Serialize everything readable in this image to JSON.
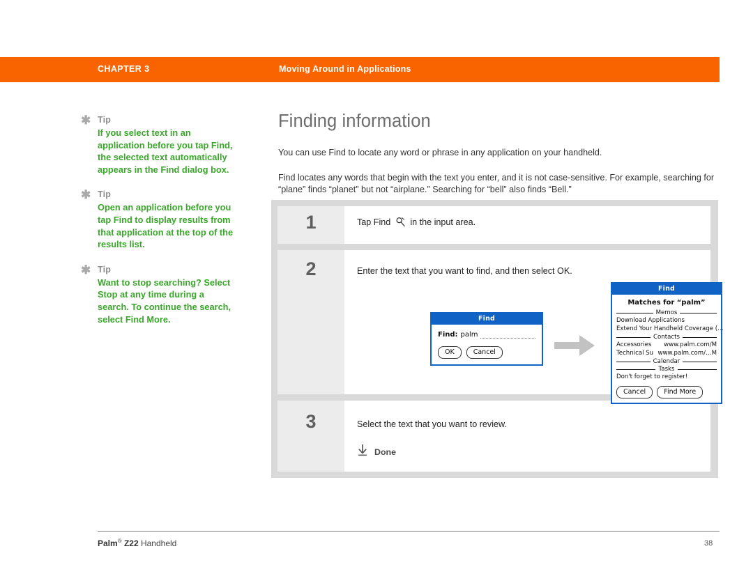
{
  "header": {
    "chapter": "CHAPTER 3",
    "section": "Moving Around in Applications",
    "bar_color": "#FA6400"
  },
  "sidebar": {
    "tips": [
      {
        "label": "Tip",
        "text": "If you select text in an application before you tap Find, the selected text automatically appears in the Find dialog box."
      },
      {
        "label": "Tip",
        "text": "Open an application before you tap Find to display results from that application at the top of the results list."
      },
      {
        "label": "Tip",
        "text": "Want to stop searching? Select Stop at any time during a search. To continue the search, select Find More."
      }
    ],
    "tip_color": "#3AA62B"
  },
  "main": {
    "title": "Finding information",
    "paragraphs": [
      "You can use Find to locate any word or phrase in any application on your handheld.",
      "Find locates any words that begin with the text you enter, and it is not case-sensitive. For example, searching for “plane” finds “planet” but not “airplane.” Searching for “bell” also finds “Bell.”"
    ]
  },
  "steps": [
    {
      "number": "1",
      "text_before": "Tap Find",
      "text_after": "in the input area."
    },
    {
      "number": "2",
      "text": "Enter the text that you want to find, and then select OK."
    },
    {
      "number": "3",
      "text": "Select the text that you want to review.",
      "done_label": "Done"
    }
  ],
  "find_dialog": {
    "title": "Find",
    "field_label": "Find:",
    "field_value": "palm",
    "ok_label": "OK",
    "cancel_label": "Cancel",
    "title_bar_color": "#1062C4"
  },
  "results_dialog": {
    "title": "Find",
    "heading": "Matches for “palm”",
    "groups": [
      {
        "name": "Memos",
        "items": [
          {
            "left": "Download Applications"
          },
          {
            "left": "Extend Your Handheld Coverage (…"
          }
        ]
      },
      {
        "name": "Contacts",
        "items": [
          {
            "left": "Accessories",
            "right": "www.palm.com/M"
          },
          {
            "left": "Technical Su",
            "right": "www.palm.com/…M"
          }
        ]
      },
      {
        "name": "Calendar",
        "items": []
      },
      {
        "name": "Tasks",
        "items": [
          {
            "left": "Don't forget to register!"
          }
        ]
      }
    ],
    "cancel_label": "Cancel",
    "find_more_label": "Find More"
  },
  "footer": {
    "brand": "Palm",
    "registered": "®",
    "model": "Z22",
    "product": "Handheld",
    "page_number": "38"
  }
}
